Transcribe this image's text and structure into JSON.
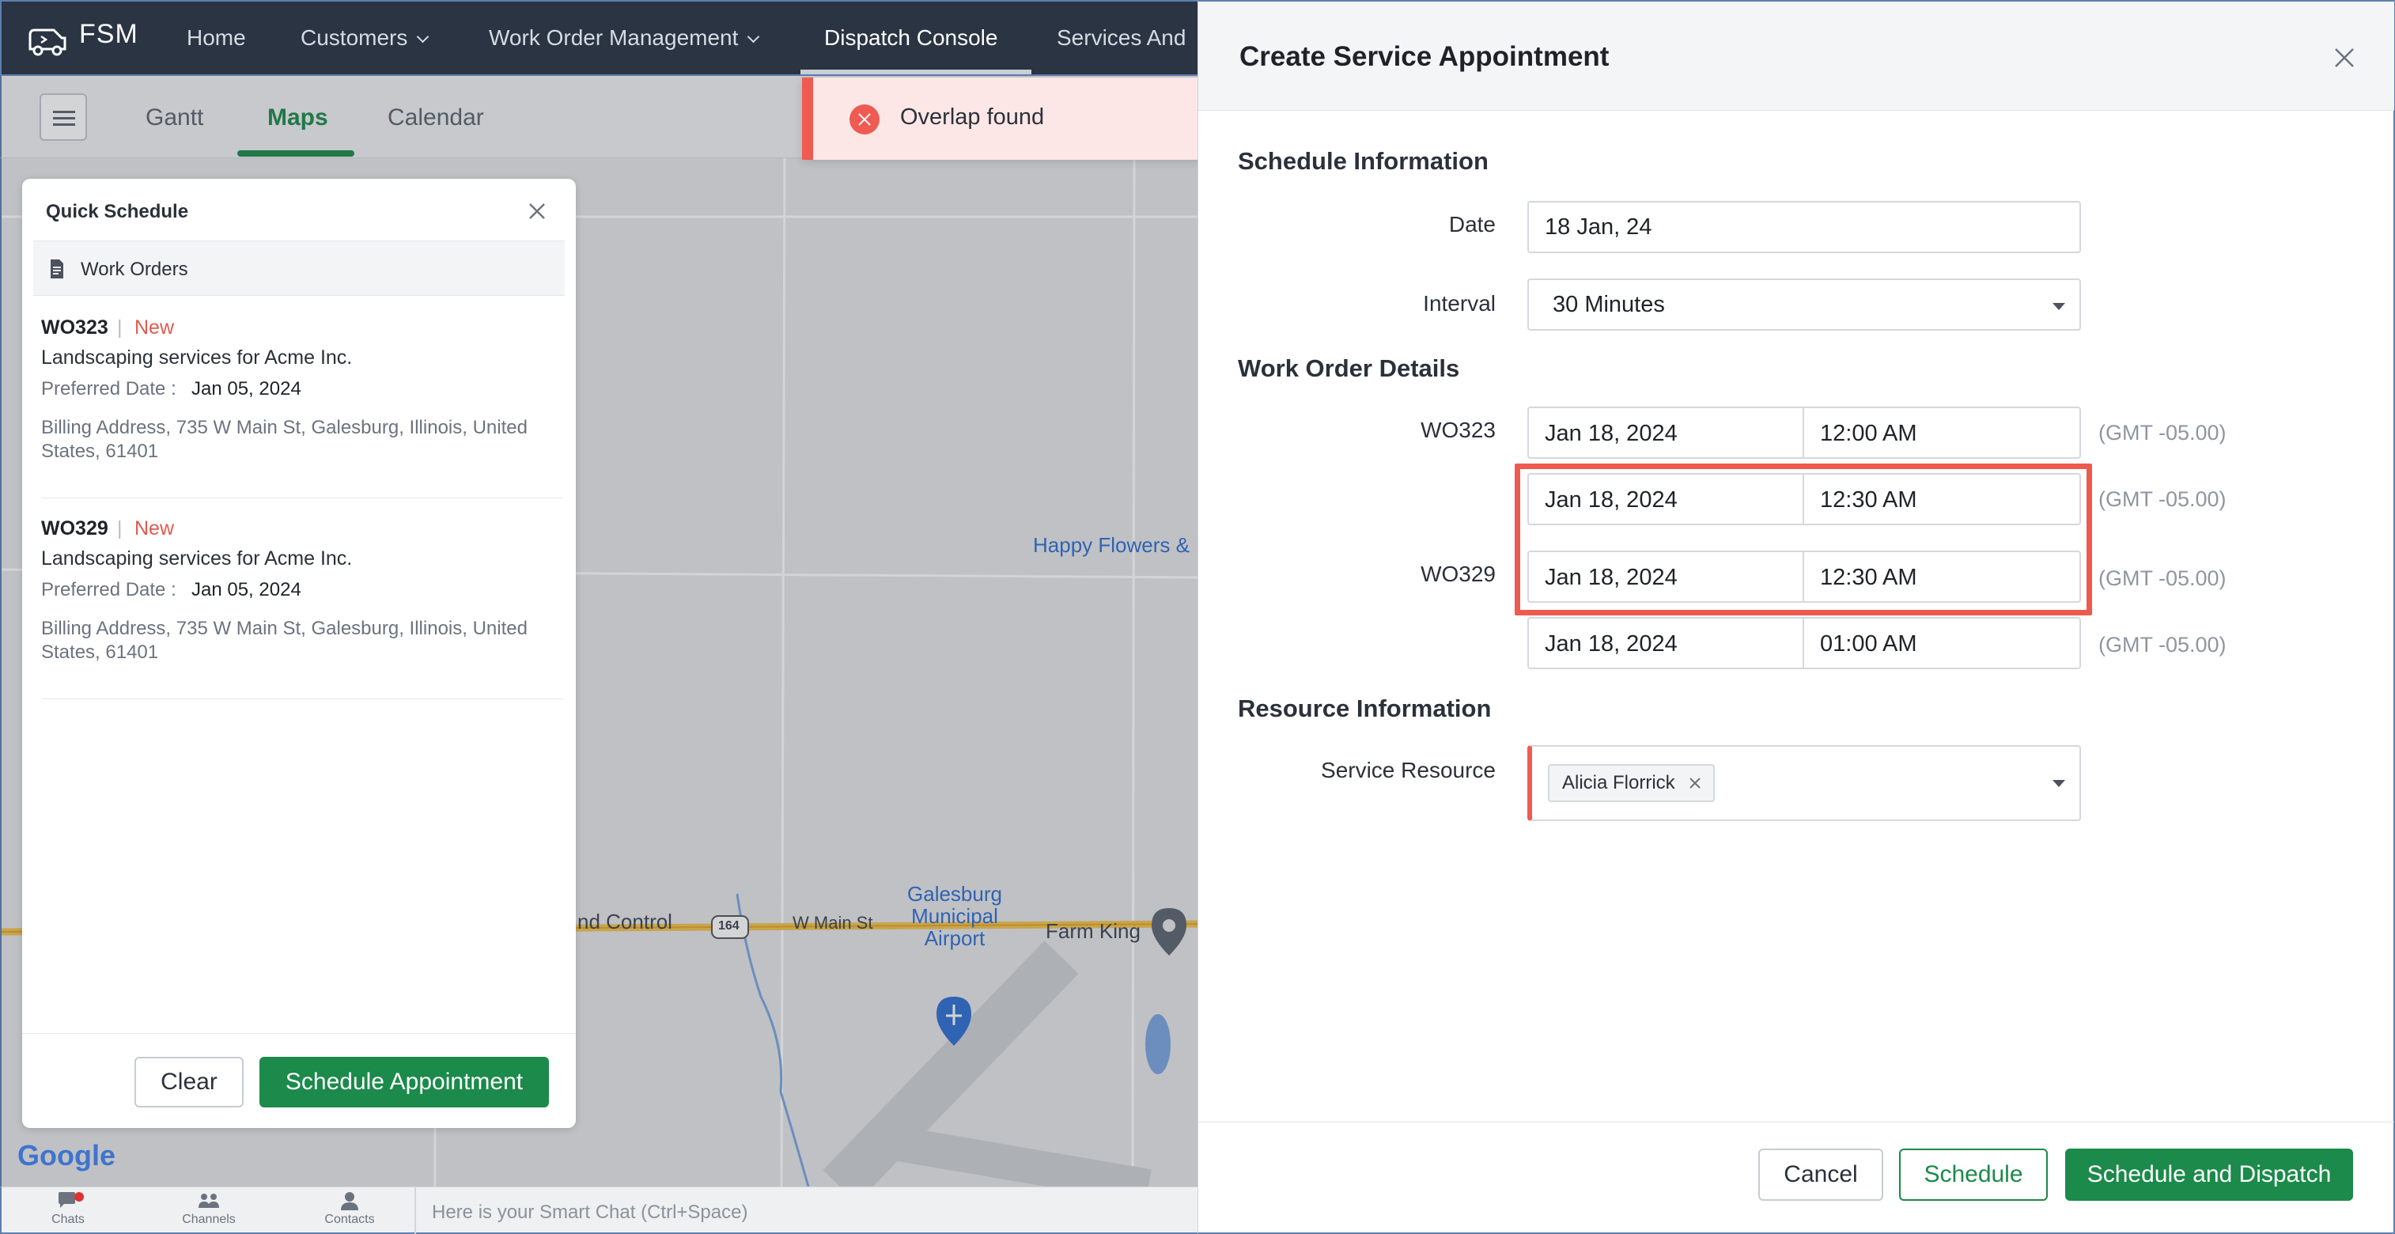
{
  "nav": {
    "brand": "FSM",
    "items": [
      {
        "label": "Home",
        "has_dropdown": false
      },
      {
        "label": "Customers",
        "has_dropdown": true
      },
      {
        "label": "Work Order Management",
        "has_dropdown": true
      },
      {
        "label": "Dispatch Console",
        "has_dropdown": false,
        "active": true
      },
      {
        "label": "Services And",
        "has_dropdown": false
      }
    ]
  },
  "view_tabs": {
    "items": [
      {
        "label": "Gantt"
      },
      {
        "label": "Maps",
        "active": true
      },
      {
        "label": "Calendar"
      }
    ],
    "active_color": "#1b8a4a"
  },
  "map": {
    "labels": {
      "happy_flowers": "Happy Flowers &",
      "airport_line1": "Galesburg",
      "airport_line2": "Municipal",
      "airport_line3": "Airport",
      "farm_king": "Farm King",
      "main_st": "W Main St",
      "route_shield": "164",
      "control": "nd Control"
    },
    "google_logo": "Google"
  },
  "quick_schedule": {
    "title": "Quick Schedule",
    "subheader": "Work Orders",
    "work_orders": [
      {
        "id": "WO323",
        "separator": "|",
        "status": "New",
        "description": "Landscaping services for Acme Inc.",
        "preferred_label": "Preferred Date :",
        "preferred_date": "Jan 05, 2024",
        "address": "Billing Address, 735 W Main St, Galesburg, Illinois, United States, 61401"
      },
      {
        "id": "WO329",
        "separator": "|",
        "status": "New",
        "description": "Landscaping services for Acme Inc.",
        "preferred_label": "Preferred Date :",
        "preferred_date": "Jan 05, 2024",
        "address": "Billing Address, 735 W Main St, Galesburg, Illinois, United States, 61401"
      }
    ],
    "clear_label": "Clear",
    "schedule_label": "Schedule Appointment"
  },
  "chat_bar": {
    "items": [
      {
        "label": "Chats",
        "icon": "chat-icon"
      },
      {
        "label": "Channels",
        "icon": "channels-icon"
      },
      {
        "label": "Contacts",
        "icon": "contacts-icon"
      }
    ],
    "placeholder": "Here is your Smart Chat (Ctrl+Space)"
  },
  "toast": {
    "message": "Overlap found",
    "type": "error",
    "color": "#ef5b52"
  },
  "panel": {
    "title": "Create Service Appointment",
    "schedule_section": "Schedule Information",
    "date_label": "Date",
    "date_value": "18 Jan, 24",
    "interval_label": "Interval",
    "interval_value": "30 Minutes",
    "work_order_section": "Work Order Details",
    "work_orders": [
      {
        "id": "WO323",
        "start": {
          "date": "Jan 18, 2024",
          "time": "12:00 AM",
          "tz": "(GMT -05.00)"
        },
        "end": {
          "date": "Jan 18, 2024",
          "time": "12:30 AM",
          "tz": "(GMT -05.00)"
        }
      },
      {
        "id": "WO329",
        "start": {
          "date": "Jan 18, 2024",
          "time": "12:30 AM",
          "tz": "(GMT -05.00)"
        },
        "end": {
          "date": "Jan 18, 2024",
          "time": "01:00 AM",
          "tz": "(GMT -05.00)"
        }
      }
    ],
    "resource_section": "Resource Information",
    "service_resource_label": "Service Resource",
    "service_resource_value": "Alicia Florrick",
    "buttons": {
      "cancel": "Cancel",
      "schedule": "Schedule",
      "schedule_dispatch": "Schedule and Dispatch"
    },
    "highlight_color": "#ee5a4e",
    "accent_color": "#1b8a4a"
  }
}
